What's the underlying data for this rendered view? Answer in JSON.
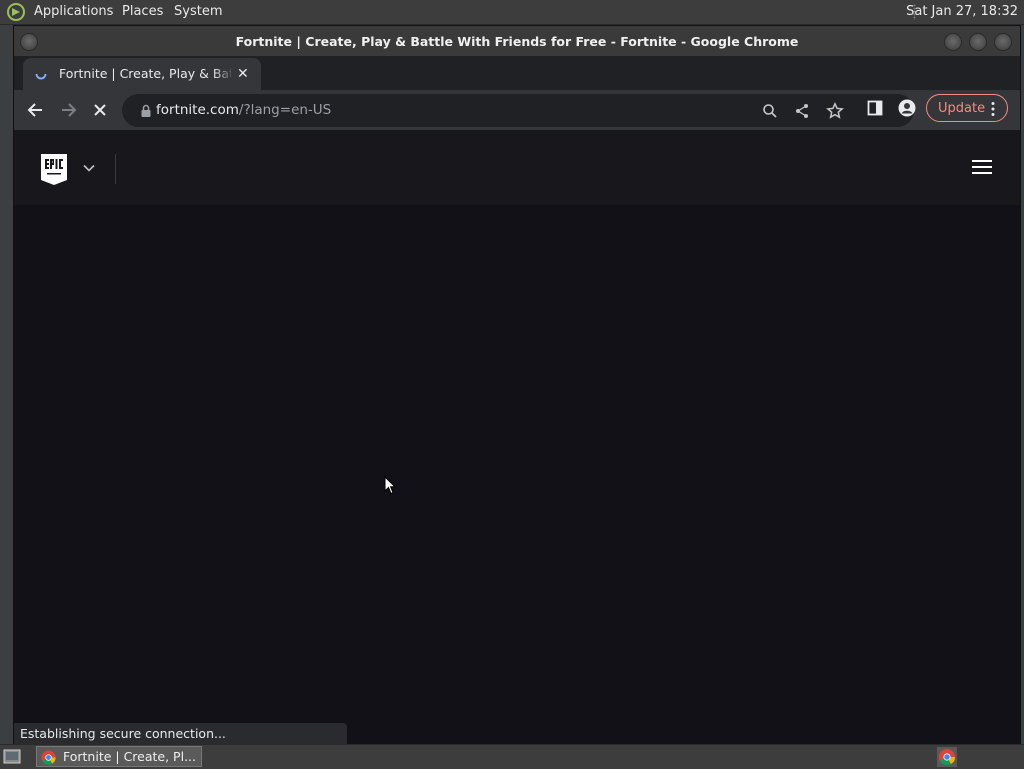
{
  "top_panel": {
    "menus": [
      "Applications",
      "Places",
      "System"
    ],
    "clock": "Sat Jan 27, 18:32"
  },
  "window": {
    "title": "Fortnite | Create, Play & Battle With Friends for Free - Fortnite - Google Chrome"
  },
  "tab": {
    "title": "Fortnite | Create, Play & Battle With Friends for Free - Fortnite",
    "close_glyph": "✕",
    "new_tab_glyph": "+"
  },
  "toolbar": {
    "url_host": "fortnite.com",
    "url_rest": "/?lang=en-US",
    "update_label": "Update"
  },
  "page": {
    "status": "Establishing secure connection..."
  },
  "taskbar": {
    "item_label": "Fortnite | Create, Pl..."
  },
  "colors": {
    "page_background": "#121117",
    "site_header": "#18181c",
    "update_accent": "#f28b82"
  }
}
